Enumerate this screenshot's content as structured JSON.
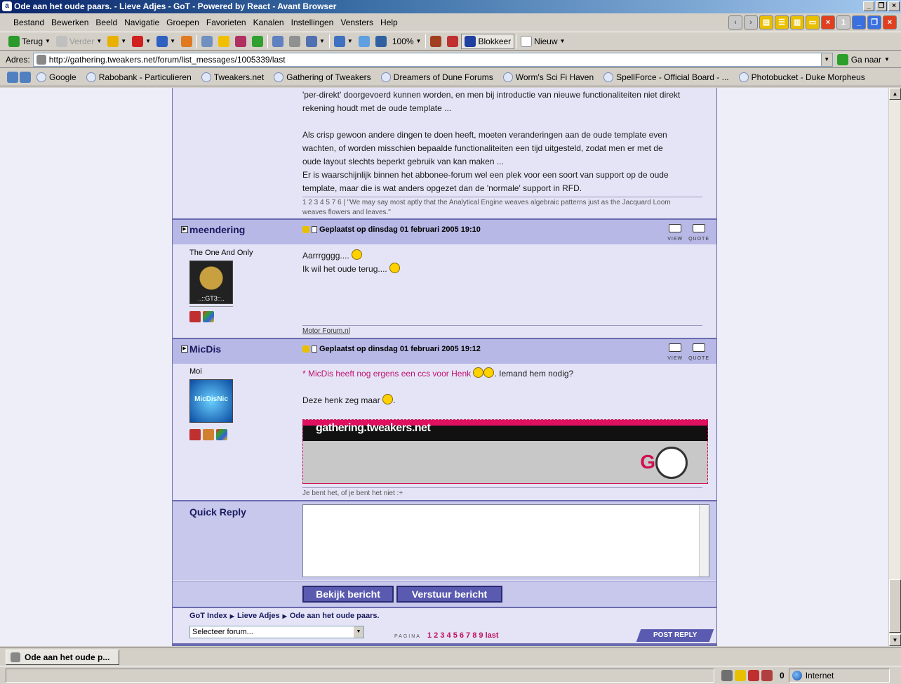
{
  "window": {
    "title": "Ode aan het oude paars. - Lieve Adjes - GoT - Powered by React - Avant Browser"
  },
  "menu": [
    "Bestand",
    "Bewerken",
    "Beeld",
    "Navigatie",
    "Groepen",
    "Favorieten",
    "Kanalen",
    "Instellingen",
    "Vensters",
    "Help"
  ],
  "mdi_buttons": {
    "count": "1"
  },
  "toolbar": {
    "back": "Terug",
    "forward": "Verder",
    "zoom": "100%",
    "block": "Blokkeer",
    "new": "Nieuw"
  },
  "address": {
    "label": "Adres:",
    "url": "http://gathering.tweakers.net/forum/list_messages/1005339/last",
    "go": "Ga naar"
  },
  "links": [
    "Google",
    "Rabobank - Particulieren",
    "Tweakers.net",
    "Gathering of Tweakers",
    "Dreamers of Dune Forums",
    "Worm's Sci Fi Haven",
    "SpellForce - Official Board - ...",
    "Photobucket - Duke Morpheus"
  ],
  "previous_post": {
    "lines": [
      "'per-direkt' doorgevoerd kunnen worden, en men bij introductie van nieuwe functionaliteiten niet direkt",
      "rekening houdt met de oude template ...",
      "",
      "Als crisp gewoon andere dingen te doen heeft, moeten veranderingen aan de oude template even",
      "wachten, of worden misschien bepaalde functionaliteiten een tijd uitgesteld, zodat men er met de",
      "oude layout slechts beperkt gebruik van kan maken ...",
      "Er is waarschijnlijk binnen het abbonee-forum wel een plek voor een soort van support op de oude",
      "template, maar die is wat anders opgezet dan de 'normale' support in RFD."
    ],
    "signature": "1 2 3 4 5 7 6 | \"We may say most aptly that the Analytical Engine weaves algebraic patterns just as the Jacquard Loom weaves flowers and leaves.\""
  },
  "posts": [
    {
      "username": "meendering",
      "posted": "Geplaatst op dinsdag 01 februari 2005 19:10",
      "user_title": "The One And Only",
      "avatar_text": "..::GT3::..",
      "body_line1": "Aarrrgggg....",
      "body_line2": "Ik wil het oude terug....",
      "signature": "Motor Forum.nl",
      "view_label": "VIEW",
      "quote_label": "QUOTE"
    },
    {
      "username": "MicDis",
      "posted": "Geplaatst op dinsdag 01 februari 2005 19:12",
      "user_title": "Moi",
      "avatar_text": "MicDisNic",
      "body_pink": "* MicDis heeft nog ergens een ccs voor Henk",
      "body_rest": ". Iemand hem nodig?",
      "body_line2": "Deze henk zeg maar",
      "body_line2_end": ".",
      "banner_text": "gathering.tweakers.net",
      "signature": "Je bent het, of je bent het niet :+",
      "view_label": "VIEW",
      "quote_label": "QUOTE"
    }
  ],
  "quick_reply": {
    "label": "Quick Reply",
    "preview_btn": "Bekijk bericht",
    "send_btn": "Verstuur bericht"
  },
  "footer": {
    "breadcrumb": [
      "GoT Index",
      "Lieve Adjes",
      "Ode aan het oude paars."
    ],
    "select_forum": "Selecteer forum...",
    "pagina_label": "PAGINA",
    "pages": "1 2 3 4 5 6 7 8 9",
    "last": "last",
    "post_reply": "POST REPLY"
  },
  "taskbar": {
    "tab": "Ode aan het oude p..."
  },
  "status": {
    "count": "0",
    "zone": "Internet"
  }
}
